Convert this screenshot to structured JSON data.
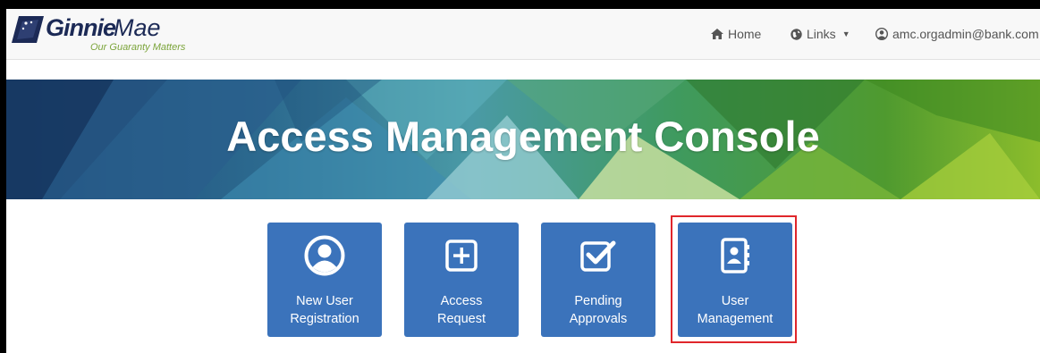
{
  "logo": {
    "brand_first": "Ginnie",
    "brand_second": "Mae",
    "tagline": "Our Guaranty Matters"
  },
  "nav": {
    "home_label": "Home",
    "links_label": "Links",
    "user_email": "amc.orgadmin@bank.com"
  },
  "banner": {
    "title": "Access Management Console"
  },
  "tiles": [
    {
      "line1": "New User",
      "line2": "Registration",
      "icon": "user-circle-icon"
    },
    {
      "line1": "Access",
      "line2": "Request",
      "icon": "plus-square-icon"
    },
    {
      "line1": "Pending",
      "line2": "Approvals",
      "icon": "check-square-icon"
    },
    {
      "line1": "User",
      "line2": "Management",
      "icon": "address-book-icon"
    }
  ],
  "colors": {
    "tile": "#3b73bb",
    "highlight": "#e0262b",
    "brand_navy": "#1c2a56",
    "brand_green": "#7ba43a"
  }
}
